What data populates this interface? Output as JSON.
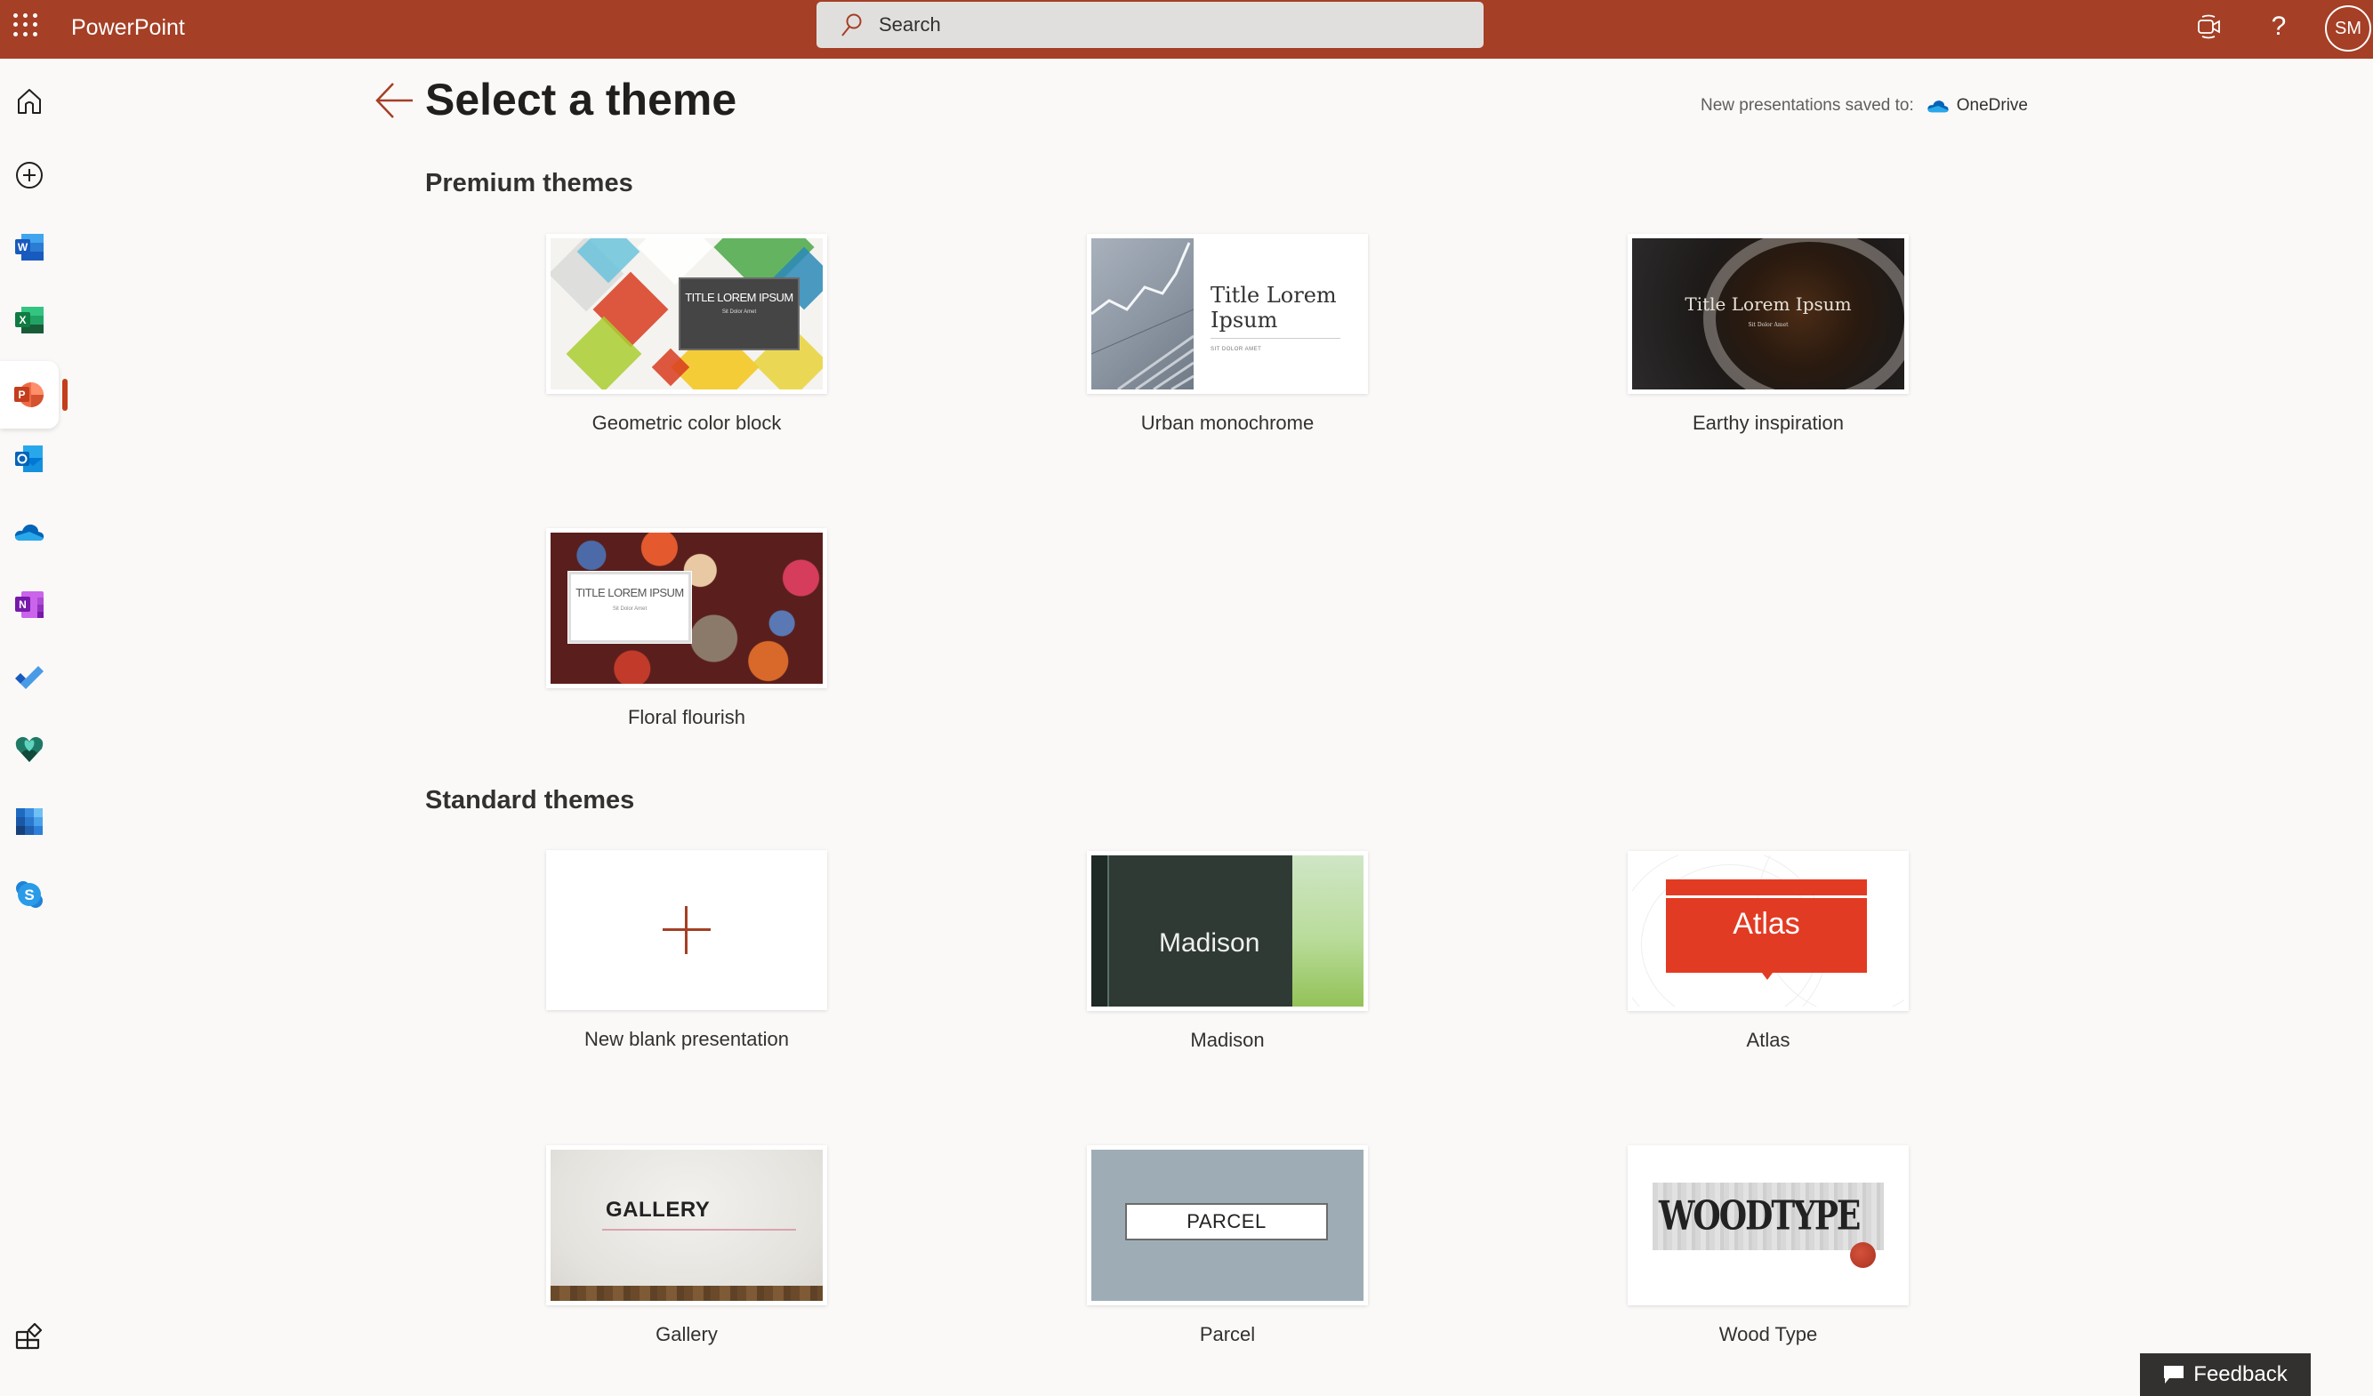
{
  "app": {
    "name": "PowerPoint",
    "brand_color": "#a53f26"
  },
  "topbar": {
    "search_placeholder": "Search",
    "help_label": "?",
    "avatar_initials": "SM"
  },
  "rail": {
    "items": [
      {
        "name": "home",
        "label": "Home"
      },
      {
        "name": "create",
        "label": "Create"
      },
      {
        "name": "word",
        "label": "Word"
      },
      {
        "name": "excel",
        "label": "Excel"
      },
      {
        "name": "powerpoint",
        "label": "PowerPoint",
        "active": true
      },
      {
        "name": "outlook",
        "label": "Outlook"
      },
      {
        "name": "onedrive",
        "label": "OneDrive"
      },
      {
        "name": "onenote",
        "label": "OneNote"
      },
      {
        "name": "todo",
        "label": "To Do"
      },
      {
        "name": "family-safety",
        "label": "Family Safety"
      },
      {
        "name": "calendar",
        "label": "Calendar"
      },
      {
        "name": "skype",
        "label": "Skype"
      }
    ],
    "apps_label": "All apps"
  },
  "header": {
    "title": "Select a theme",
    "saved_to_label": "New presentations saved to:",
    "saved_to_location": "OneDrive"
  },
  "sections": {
    "premium": {
      "title": "Premium themes",
      "themes": [
        {
          "label": "Geometric color block",
          "preview_title": "TITLE LOREM IPSUM",
          "preview_subtitle": "Sit Dolor Amet"
        },
        {
          "label": "Urban monochrome",
          "preview_title": "Title Lorem Ipsum",
          "preview_subtitle": "SIT DOLOR AMET"
        },
        {
          "label": "Earthy inspiration",
          "preview_title": "Title Lorem Ipsum",
          "preview_subtitle": "Sit Dolor Amet"
        },
        {
          "label": "Floral flourish",
          "preview_title": "TITLE LOREM IPSUM",
          "preview_subtitle": "Sit Dolor Amet"
        }
      ]
    },
    "standard": {
      "title": "Standard themes",
      "themes": [
        {
          "label": "New blank presentation"
        },
        {
          "label": "Madison",
          "preview_title": "Madison"
        },
        {
          "label": "Atlas",
          "preview_title": "Atlas"
        },
        {
          "label": "Gallery",
          "preview_title": "GALLERY"
        },
        {
          "label": "Parcel",
          "preview_title": "PARCEL"
        },
        {
          "label": "Wood Type",
          "preview_title": "WOODTYPE"
        }
      ]
    }
  },
  "feedback": {
    "label": "Feedback"
  }
}
